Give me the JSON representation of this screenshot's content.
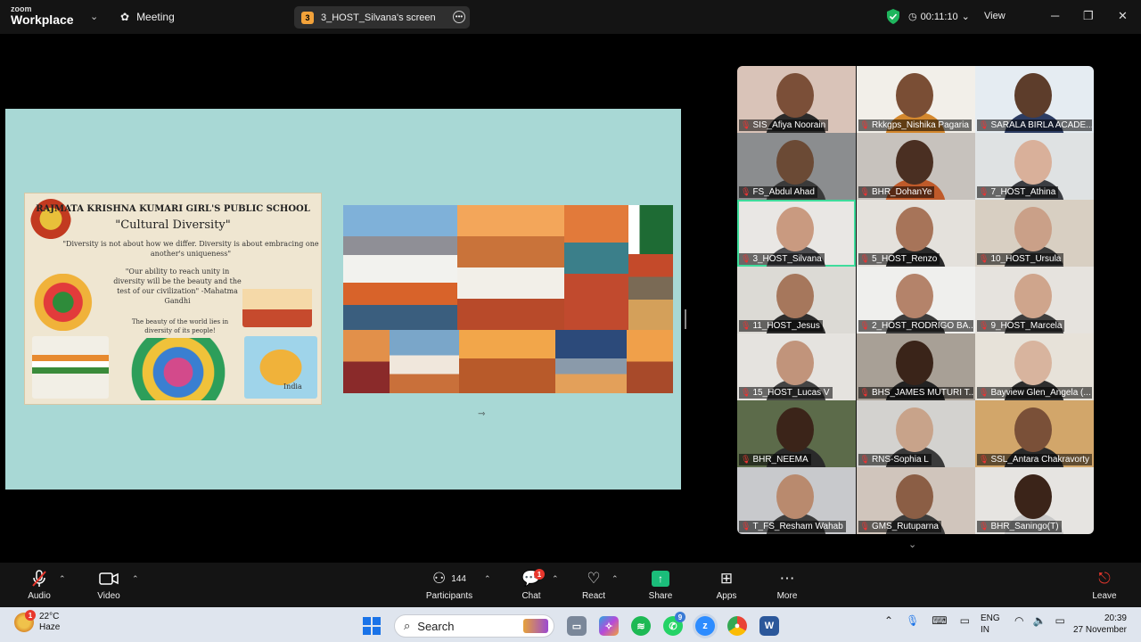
{
  "app": {
    "brand_small": "zoom",
    "brand_large": "Workplace",
    "meeting_label": "Meeting",
    "share_pill": "3_HOST_Silvana's screen",
    "share_pill_num": "3",
    "timer": "00:11:10",
    "view_label": "View"
  },
  "slide_left": {
    "title": "RAJMATA KRISHNA KUMARI GIRL'S PUBLIC SCHOOL",
    "subtitle": "\"Cultural Diversity\"",
    "quote1": "\"Diversity is not about how we differ. Diversity is about embracing one another's uniqueness\"",
    "quote2": "\"Our ability to reach unity in diversity will be the beauty and the test of our civilization\" -Mahatma Gandhi",
    "quote3": "The beauty of the world lies in diversity of its people!",
    "map_label": "India"
  },
  "participants": [
    {
      "name": "SIS_Afiya Noorain",
      "skin": "#7b4f38",
      "bg": "#d9c3b8",
      "shirt": "#2a2a2a"
    },
    {
      "name": "Rkkgps_Nishika Pagaria",
      "skin": "#7a4e35",
      "bg": "#f2efe9",
      "shirt": "#d4882e"
    },
    {
      "name": "SARALA BIRLA ACADE...",
      "skin": "#5d3d2b",
      "bg": "#e5ecf2",
      "shirt": "#2d3d63"
    },
    {
      "name": "FS_Abdul Ahad",
      "skin": "#6b4a35",
      "bg": "#8b8d8f",
      "shirt": "#3a3a3a"
    },
    {
      "name": "BHR_DohanYe",
      "skin": "#4a2f22",
      "bg": "#c7c2bd",
      "shirt": "#bf5a2a"
    },
    {
      "name": "7_HOST_Athina",
      "skin": "#d9b09a",
      "bg": "#dfe2e3",
      "shirt": "#3b3d42"
    },
    {
      "name": "3_HOST_Silvana",
      "skin": "#c99a80",
      "bg": "#e9e7e4",
      "shirt": "#4d4d50"
    },
    {
      "name": "5_HOST_Renzo",
      "skin": "#a77459",
      "bg": "#e4e1dc",
      "shirt": "#2a2a2a"
    },
    {
      "name": "10_HOST_Ursula",
      "skin": "#caa088",
      "bg": "#d8cfc2",
      "shirt": "#3a3a3a"
    },
    {
      "name": "11_HOST_Jesus",
      "skin": "#a6775c",
      "bg": "#dcdad5",
      "shirt": "#2c2c2c"
    },
    {
      "name": "2_HOST_RODRIGO BA...",
      "skin": "#b4836a",
      "bg": "#efefed",
      "shirt": "#3a3a3a"
    },
    {
      "name": "9_HOST_Marcela",
      "skin": "#cfa58c",
      "bg": "#e6e3de",
      "shirt": "#3d3d3d"
    },
    {
      "name": "15_HOST_Lucas V",
      "skin": "#c1947b",
      "bg": "#e5e3df",
      "shirt": "#444"
    },
    {
      "name": "BHS_JAMES MUTURI T...",
      "skin": "#3a2419",
      "bg": "#a8a096",
      "shirt": "#222"
    },
    {
      "name": "Bayview Glen_Angela (...",
      "skin": "#d8b49e",
      "bg": "#e7e2d9",
      "shirt": "#2e2e2e"
    },
    {
      "name": "BHR_NEEMA",
      "skin": "#3b2419",
      "bg": "#5c6b4a",
      "shirt": "#2a2a2a"
    },
    {
      "name": "RNS-Sophia L",
      "skin": "#c8a38a",
      "bg": "#d3d2cf",
      "shirt": "#3a3a3a"
    },
    {
      "name": "SSL_Antara Chakravorty",
      "skin": "#7a5038",
      "bg": "#d2a66a",
      "shirt": "#2a2a2a"
    },
    {
      "name": "T_FS_Resham Wahab",
      "skin": "#b98a6e",
      "bg": "#c8c9cc",
      "shirt": "#3c3c3c"
    },
    {
      "name": "GMS_Rutuparna",
      "skin": "#8b5e45",
      "bg": "#d0c5bc",
      "shirt": "#3a3a3a"
    },
    {
      "name": "BHR_Saningo(T)",
      "skin": "#3b2419",
      "bg": "#e6e4e1",
      "shirt": "#c8c8c8"
    }
  ],
  "toolbar": {
    "audio": "Audio",
    "video": "Video",
    "participants": "Participants",
    "participants_count": "144",
    "chat": "Chat",
    "chat_badge": "1",
    "react": "React",
    "share": "Share",
    "apps": "Apps",
    "more": "More",
    "leave": "Leave"
  },
  "taskbar": {
    "temp": "22°C",
    "weather": "Haze",
    "weather_badge": "1",
    "search": "Search",
    "whatsapp_badge": "9",
    "lang1": "ENG",
    "lang2": "IN",
    "time": "20:39",
    "date": "27 November"
  }
}
